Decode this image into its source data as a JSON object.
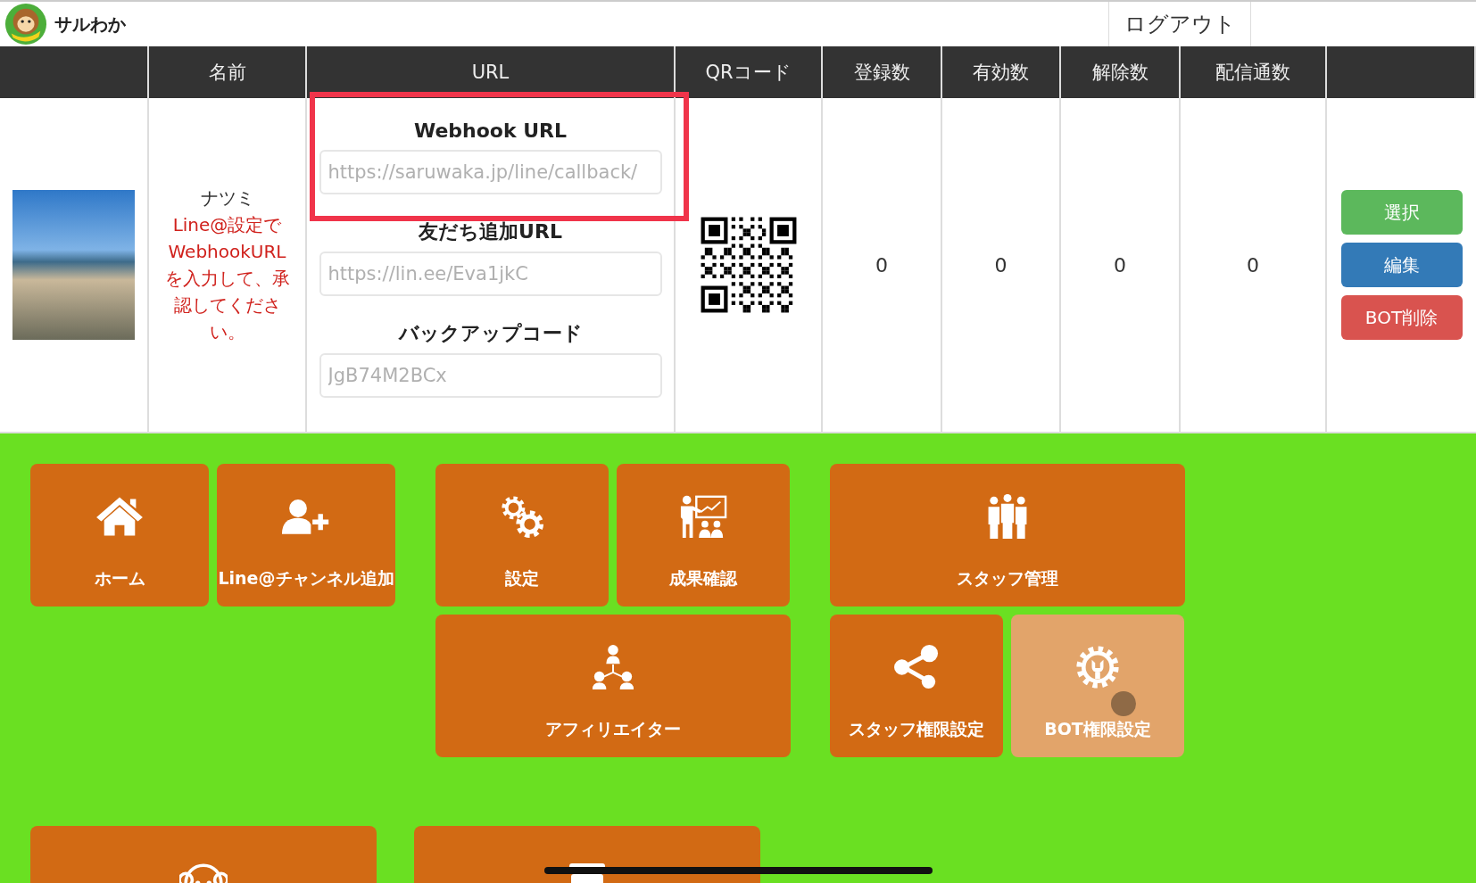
{
  "header": {
    "brand": "サルわか",
    "logout": "ログアウト"
  },
  "table": {
    "columns": [
      "名前",
      "URL",
      "QRコード",
      "登録数",
      "有効数",
      "解除数",
      "配信通数"
    ],
    "rows": [
      {
        "name": "ナツミ",
        "note": "Line@設定でWebhookURLを入力して、承認してください。",
        "url_fields": [
          {
            "label": "Webhook URL",
            "value": "https://saruwaka.jp/line/callback/"
          },
          {
            "label": "友だち追加URL",
            "value": "https://lin.ee/Eva1jkC"
          },
          {
            "label": "バックアップコード",
            "value": "JgB74M2BCx"
          }
        ],
        "counts": [
          "0",
          "0",
          "0",
          "0"
        ],
        "actions": [
          {
            "label": "選択",
            "kind": "success"
          },
          {
            "label": "編集",
            "kind": "primary"
          },
          {
            "label": "BOT削除",
            "kind": "danger"
          }
        ]
      }
    ]
  },
  "menu_groups": [
    {
      "tiles": [
        {
          "label": "ホーム",
          "kind": "half",
          "disabled": false
        },
        {
          "label": "Line@チャンネル追加",
          "kind": "half",
          "disabled": false
        }
      ]
    },
    {
      "tiles": [
        {
          "label": "設定",
          "kind": "half",
          "disabled": false
        },
        {
          "label": "成果確認",
          "kind": "half",
          "disabled": false
        },
        {
          "label": "アフィリエイター",
          "kind": "full",
          "disabled": false
        }
      ]
    },
    {
      "tiles": [
        {
          "label": "スタッフ管理",
          "kind": "full",
          "disabled": false
        },
        {
          "label": "スタッフ権限設定",
          "kind": "half",
          "disabled": false
        },
        {
          "label": "BOT権限設定",
          "kind": "half",
          "disabled": true
        }
      ]
    }
  ],
  "bottom_tiles": [
    {
      "kind": "full",
      "disabled": false
    },
    {
      "kind": "full",
      "disabled": false
    }
  ]
}
